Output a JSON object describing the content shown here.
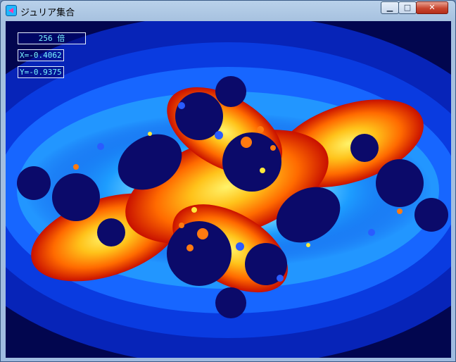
{
  "window": {
    "title": "ジュリア集合",
    "controls": {
      "minimize": "▁",
      "maximize": "□",
      "close": "✕"
    }
  },
  "overlay": {
    "zoom": "256 倍",
    "x": "X=-0.4062",
    "y": "Y=-0.9375"
  },
  "colors": {
    "background": "#02064f",
    "outer_blue": "#0a2fd8",
    "mid_blue": "#1880ff",
    "cyan": "#40d8ff",
    "pale": "#d8fbff",
    "yellow": "#ffe93a",
    "orange": "#ff8a00",
    "red": "#d81800",
    "dark_core": "#0b0a6a"
  }
}
